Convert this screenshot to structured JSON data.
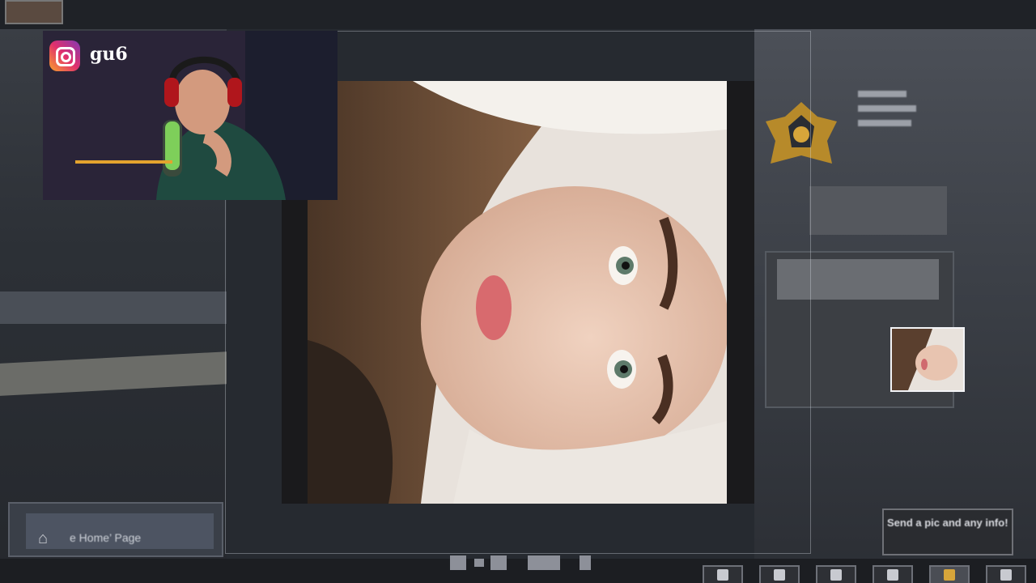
{
  "webcam": {
    "handle": "gu6",
    "platform_icon": "instagram-icon"
  },
  "home_panel": {
    "icon": "home-icon",
    "label": "e Home’ Page"
  },
  "chat_bubble": {
    "text": "Send a pic and any info!"
  },
  "thumbnail": {
    "label": ""
  },
  "top_bar": {
    "text": ""
  },
  "dock": {
    "count": 6,
    "active_index": 4
  },
  "colors": {
    "accent_gold": "#d7a53a",
    "instagram_pink": "#e1306c",
    "frame": "#dfe3ea"
  }
}
